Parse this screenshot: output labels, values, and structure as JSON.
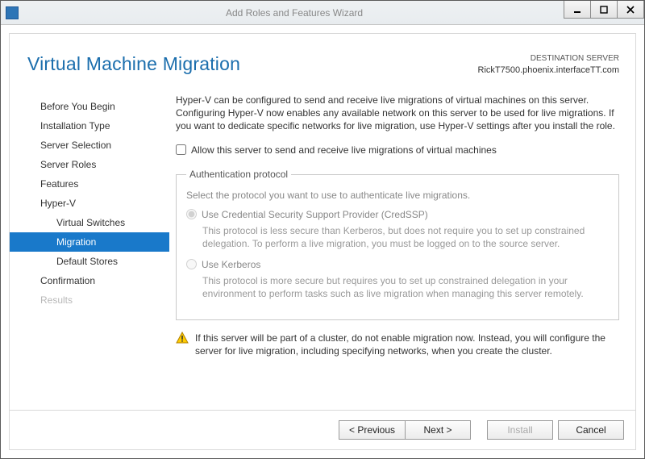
{
  "window": {
    "title": "Add Roles and Features Wizard"
  },
  "header": {
    "title": "Virtual Machine Migration",
    "dest_label": "DESTINATION SERVER",
    "dest_value": "RickT7500.phoenix.interfaceTT.com"
  },
  "nav": {
    "items": [
      {
        "label": "Before You Begin"
      },
      {
        "label": "Installation Type"
      },
      {
        "label": "Server Selection"
      },
      {
        "label": "Server Roles"
      },
      {
        "label": "Features"
      },
      {
        "label": "Hyper-V"
      },
      {
        "label": "Virtual Switches",
        "sub": true
      },
      {
        "label": "Migration",
        "sub": true,
        "selected": true
      },
      {
        "label": "Default Stores",
        "sub": true
      },
      {
        "label": "Confirmation"
      },
      {
        "label": "Results",
        "disabled": true
      }
    ]
  },
  "content": {
    "intro": "Hyper-V can be configured to send and receive live migrations of virtual machines on this server. Configuring Hyper-V now enables any available network on this server to be used for live migrations. If you want to dedicate specific networks for live migration, use Hyper-V settings after you install the role.",
    "allow_label": "Allow this server to send and receive live migrations of virtual machines",
    "auth": {
      "legend": "Authentication protocol",
      "select_text": "Select the protocol you want to use to authenticate live migrations.",
      "credssp_label": "Use Credential Security Support Provider (CredSSP)",
      "credssp_desc": "This protocol is less secure than Kerberos, but does not require you to set up constrained delegation. To perform a live migration, you must be logged on to the source server.",
      "kerberos_label": "Use Kerberos",
      "kerberos_desc": "This protocol is more secure but requires you to set up constrained delegation in your environment to perform tasks such as live migration when managing this server remotely."
    },
    "warning": "If this server will be part of a cluster, do not enable migration now. Instead, you will configure the server for live migration, including specifying networks, when you create the cluster."
  },
  "footer": {
    "previous": "< Previous",
    "next": "Next >",
    "install": "Install",
    "cancel": "Cancel"
  }
}
